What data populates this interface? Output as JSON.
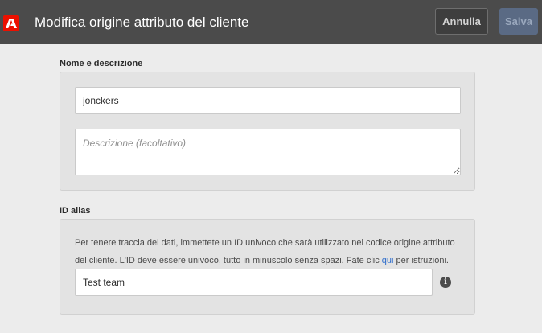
{
  "header": {
    "logo_icon": "adobe-logo-icon",
    "title": "Modifica origine attributo del cliente",
    "cancel_label": "Annulla",
    "save_label": "Salva"
  },
  "name_section": {
    "label": "Nome e descrizione",
    "name_value": "jonckers",
    "description_placeholder": "Descrizione (facoltativo)",
    "description_value": ""
  },
  "alias_section": {
    "label": "ID alias",
    "help_text_before": "Per tenere traccia dei dati, immettete un ID univoco che sarà utilizzato nel codice origine attributo del cliente. L'ID deve essere univoco, tutto in minuscolo senza spazi. Fate clic ",
    "help_link": "qui",
    "help_text_after": " per istruzioni.",
    "alias_value": "Test team",
    "info_icon": "info-icon"
  },
  "colors": {
    "header_bg": "#4b4b4b",
    "page_bg": "#ececec",
    "accent_red": "#eb1000",
    "link_blue": "#2d6ccb"
  }
}
